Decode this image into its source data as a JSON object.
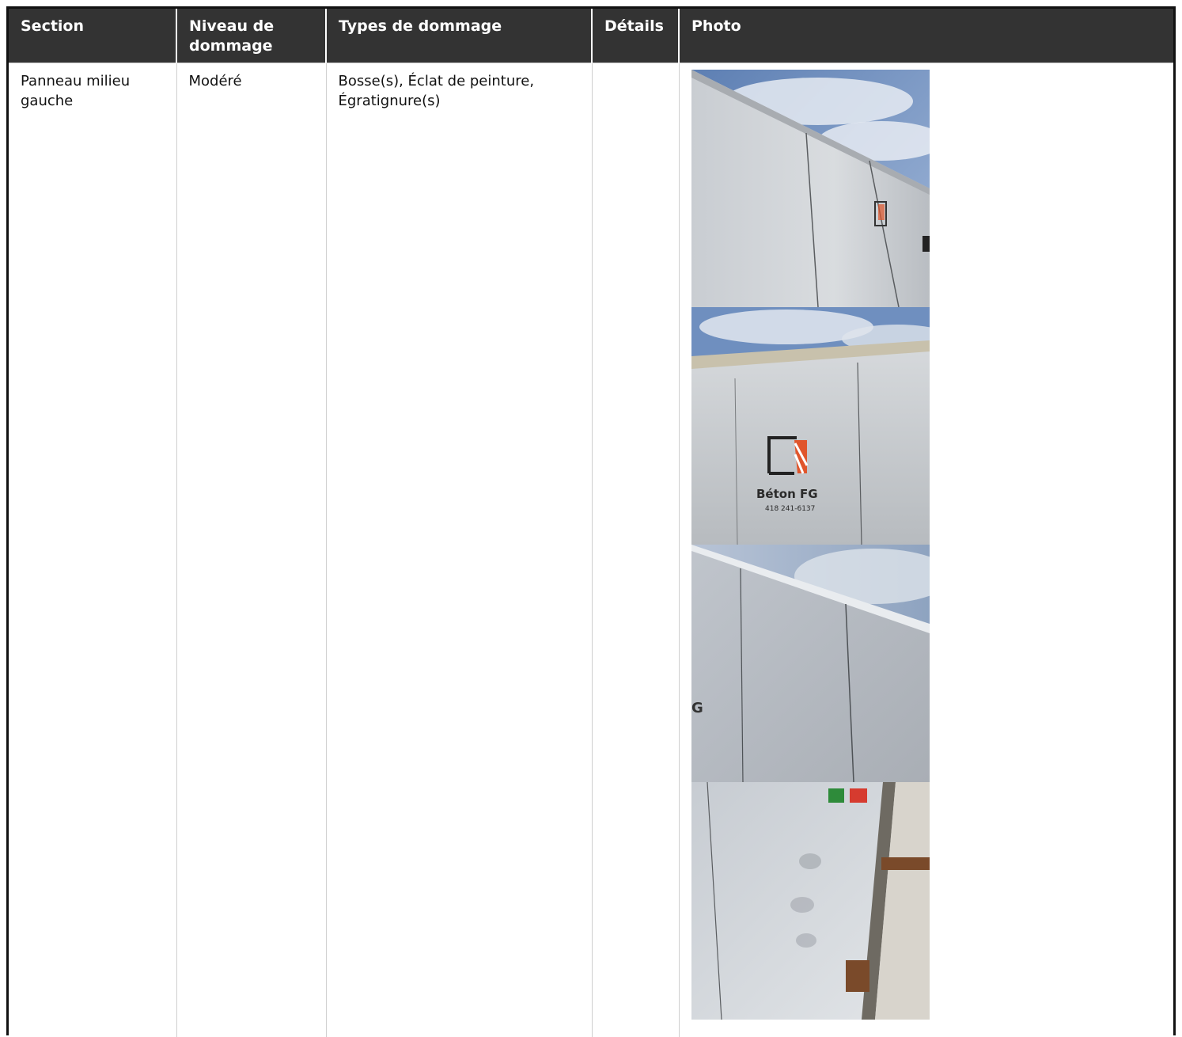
{
  "table": {
    "headers": [
      "Section",
      "Niveau de dommage",
      "Types de dommage",
      "Détails",
      "Photo"
    ],
    "rows": [
      {
        "section": "Panneau milieu gauche",
        "niveau": "Modéré",
        "types": "Bosse(s), Éclat de peinture, Égratignure(s)",
        "details": "",
        "photo_labels": {
          "logo_text": "Béton FG",
          "phone": "418 241-6137",
          "partial_letter": "G"
        }
      }
    ]
  },
  "colors": {
    "header_bg": "#333333",
    "header_text": "#ffffff",
    "grid": "#cfcfcf",
    "logo_orange": "#e0552b"
  }
}
